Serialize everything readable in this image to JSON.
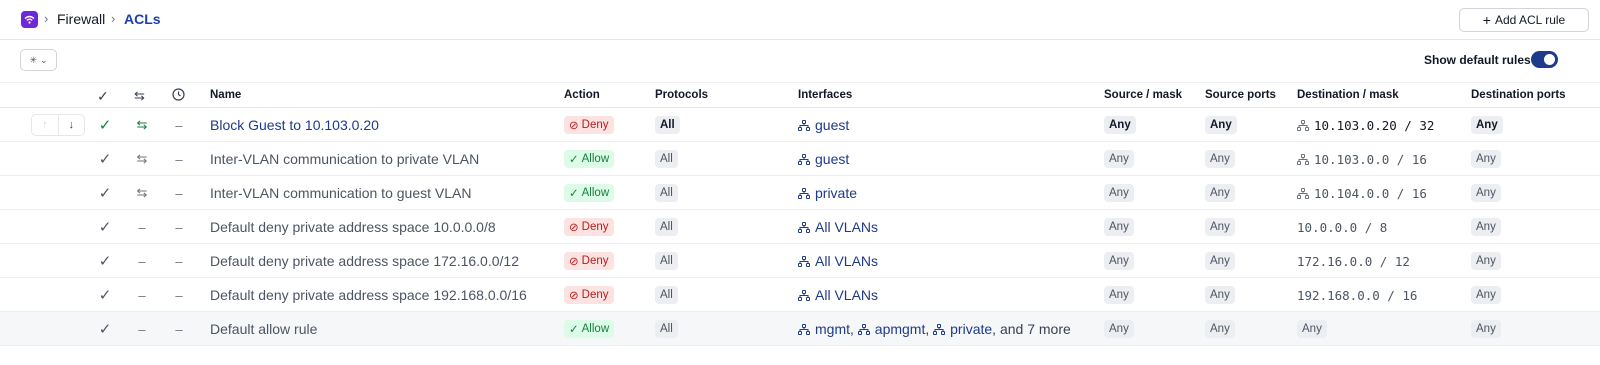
{
  "breadcrumb": {
    "root": "Firewall",
    "current": "ACLs"
  },
  "toolbar": {
    "add_label": "Add ACL rule",
    "show_default_label": "Show default rules",
    "show_default_on": true
  },
  "table": {
    "headers": {
      "name": "Name",
      "action": "Action",
      "protocols": "Protocols",
      "interfaces": "Interfaces",
      "source_mask": "Source / mask",
      "source_ports": "Source ports",
      "destination_mask": "Destination / mask",
      "destination_ports": "Destination ports"
    },
    "rows": [
      {
        "enabled": "✓",
        "bidir": "⇆",
        "schedule": "–",
        "name": "Block Guest to 10.103.0.20",
        "action": "Deny",
        "protocols": "All",
        "interfaces": [
          "guest"
        ],
        "iface_more": "",
        "source": "Any",
        "source_ports": "Any",
        "destination": "10.103.0.20 / 32",
        "destination_ports": "Any"
      },
      {
        "enabled": "✓",
        "bidir": "⇆",
        "schedule": "–",
        "name": "Inter-VLAN communication to private VLAN",
        "action": "Allow",
        "protocols": "All",
        "interfaces": [
          "guest"
        ],
        "iface_more": "",
        "source": "Any",
        "source_ports": "Any",
        "destination": "10.103.0.0 / 16",
        "destination_ports": "Any"
      },
      {
        "enabled": "✓",
        "bidir": "⇆",
        "schedule": "–",
        "name": "Inter-VLAN communication to guest VLAN",
        "action": "Allow",
        "protocols": "All",
        "interfaces": [
          "private"
        ],
        "iface_more": "",
        "source": "Any",
        "source_ports": "Any",
        "destination": "10.104.0.0 / 16",
        "destination_ports": "Any"
      },
      {
        "enabled": "✓",
        "bidir": "–",
        "schedule": "–",
        "name": "Default deny private address space 10.0.0.0/8",
        "action": "Deny",
        "protocols": "All",
        "interfaces": [
          "All VLANs"
        ],
        "iface_more": "",
        "source": "Any",
        "source_ports": "Any",
        "destination": "10.0.0.0 / 8",
        "destination_ports": "Any"
      },
      {
        "enabled": "✓",
        "bidir": "–",
        "schedule": "–",
        "name": "Default deny private address space 172.16.0.0/12",
        "action": "Deny",
        "protocols": "All",
        "interfaces": [
          "All VLANs"
        ],
        "iface_more": "",
        "source": "Any",
        "source_ports": "Any",
        "destination": "172.16.0.0 / 12",
        "destination_ports": "Any"
      },
      {
        "enabled": "✓",
        "bidir": "–",
        "schedule": "–",
        "name": "Default deny private address space 192.168.0.0/16",
        "action": "Deny",
        "protocols": "All",
        "interfaces": [
          "All VLANs"
        ],
        "iface_more": "",
        "source": "Any",
        "source_ports": "Any",
        "destination": "192.168.0.0 / 16",
        "destination_ports": "Any"
      },
      {
        "enabled": "✓",
        "bidir": "–",
        "schedule": "–",
        "name": "Default allow rule",
        "action": "Allow",
        "protocols": "All",
        "interfaces": [
          "mgmt",
          "apmgmt",
          "private"
        ],
        "iface_more": ", and 7 more",
        "source": "Any",
        "source_ports": "Any",
        "destination": "Any",
        "destination_ports": "Any"
      }
    ]
  },
  "colors": {
    "link": "#1e3a8a",
    "allow": "#15803d",
    "deny": "#b91c1c",
    "brand": "#6d28d9",
    "toggle": "#1e3a8a"
  }
}
